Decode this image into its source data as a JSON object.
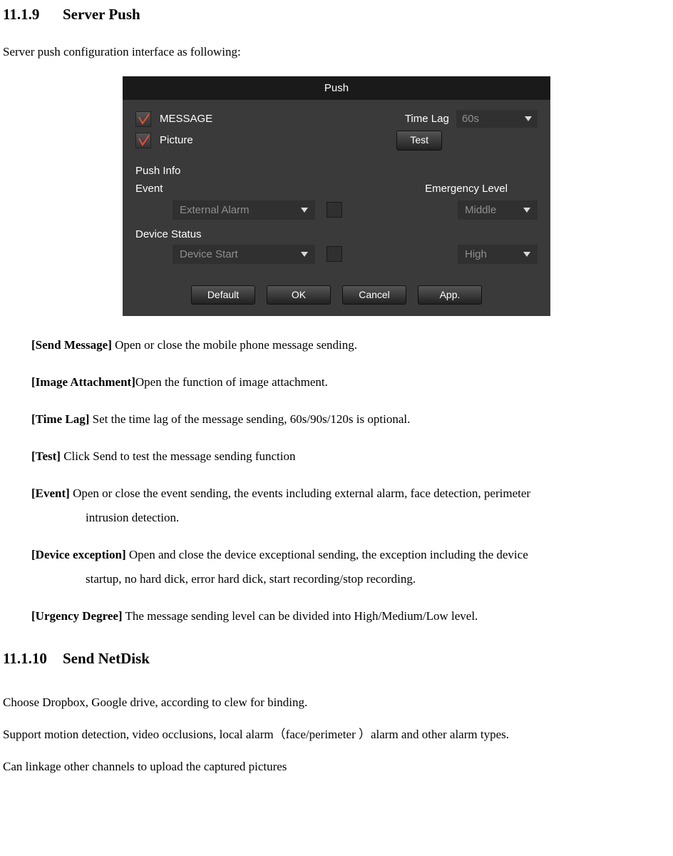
{
  "sections": {
    "serverPush": {
      "number": "11.1.9",
      "title": "Server Push"
    },
    "netdisk": {
      "number": "11.1.10",
      "title": "Send NetDisk"
    }
  },
  "intro": "Server push configuration interface as following:",
  "dialog": {
    "title": "Push",
    "message": "MESSAGE",
    "picture": "Picture",
    "timeLagLabel": "Time Lag",
    "timeLagValue": "60s",
    "testBtn": "Test",
    "pushInfo": "Push Info",
    "eventLabel": "Event",
    "emergencyLabel": "Emergency Level",
    "eventSelect": "External Alarm",
    "eventLevel": "Middle",
    "deviceStatus": "Device Status",
    "deviceSelect": "Device Start",
    "deviceLevel": "High",
    "btnDefault": "Default",
    "btnOK": "OK",
    "btnCancel": "Cancel",
    "btnApp": "App."
  },
  "defs": {
    "sendMsg": {
      "term": "[Send Message]",
      "text": " Open or close the mobile phone message sending."
    },
    "imgAtt": {
      "term": "[Image Attachment]",
      "text": "Open the function of image attachment."
    },
    "timeLag": {
      "term": "[Time Lag]",
      "text": " Set the time lag of the message sending, 60s/90s/120s is optional."
    },
    "test": {
      "term": "[Test]",
      "text": " Click Send to test the message sending function"
    },
    "event": {
      "term": "[Event]",
      "text": " Open or close the event sending, the events including external alarm, face detection, perimeter",
      "cont": "intrusion detection."
    },
    "devExc": {
      "term": "[Device exception]",
      "text": " Open and close the device exceptional sending, the exception including the device",
      "cont": "startup, no hard dick, error hard dick, start recording/stop recording."
    },
    "urgency": {
      "term": "[Urgency Degree]",
      "text": " The message sending level can be divided into High/Medium/Low level."
    }
  },
  "netdisk": {
    "p1": "Choose Dropbox, Google drive, according to clew for binding.",
    "p2": "Support motion detection, video occlusions, local alarm（face/perimeter ）alarm and other alarm types.",
    "p3": "Can linkage other channels to upload the captured pictures"
  }
}
